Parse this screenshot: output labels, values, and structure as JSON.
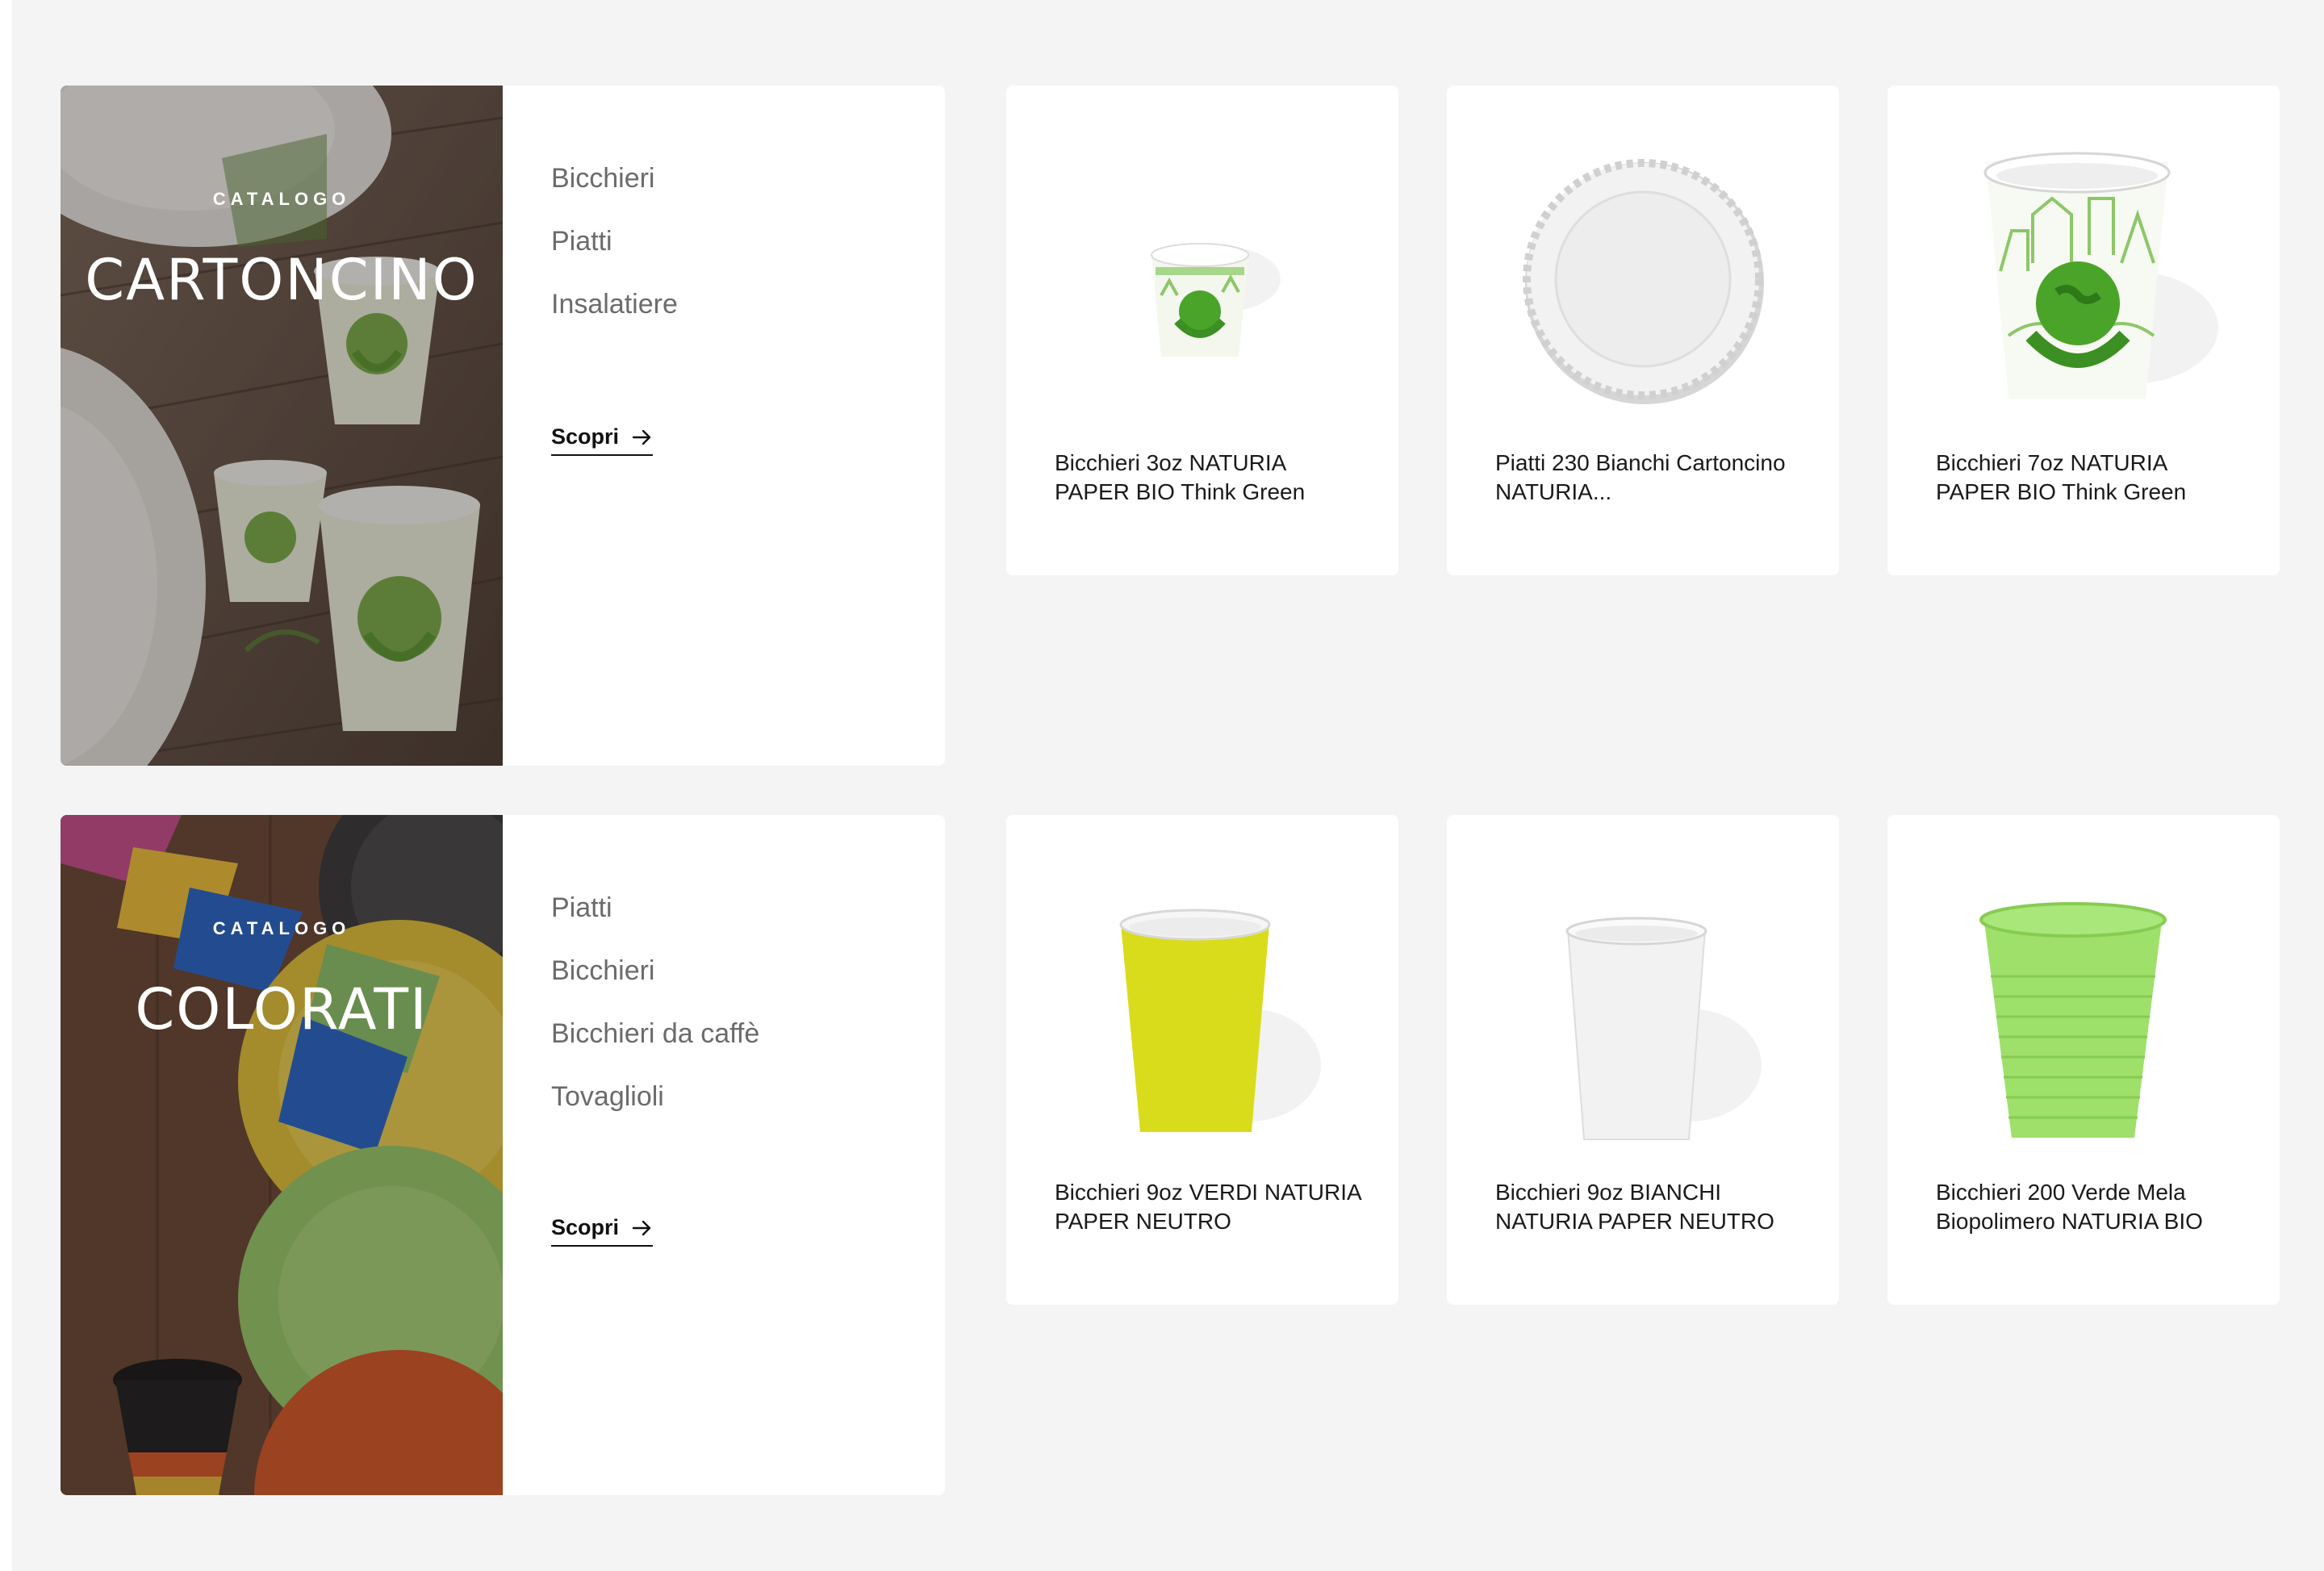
{
  "catalogs": [
    {
      "eyebrow": "CATALOGO",
      "title": "CARTONCINO",
      "links": [
        "Bicchieri",
        "Piatti",
        "Insalatiere"
      ],
      "cta": "Scopri",
      "products": [
        {
          "name": "Bicchieri 3oz NATURIA PAPER BIO Think Green",
          "visual": "small-green-print-cup"
        },
        {
          "name": "Piatti 230 Bianchi Cartoncino NATURIA...",
          "visual": "white-scalloped-plate"
        },
        {
          "name": "Bicchieri 7oz NATURIA PAPER BIO Think Green",
          "visual": "green-print-cup"
        }
      ]
    },
    {
      "eyebrow": "CATALOGO",
      "title": "COLORATI",
      "links": [
        "Piatti",
        "Bicchieri",
        "Bicchieri da caffè",
        "Tovaglioli"
      ],
      "cta": "Scopri",
      "products": [
        {
          "name": "Bicchieri 9oz VERDI NATURIA PAPER NEUTRO",
          "visual": "yellow-paper-cup",
          "color": "#d9dc1a"
        },
        {
          "name": "Bicchieri 9oz BIANCHI NATURIA PAPER NEUTRO",
          "visual": "white-paper-cup",
          "color": "#f2f2f2"
        },
        {
          "name": "Bicchieri 200 Verde Mela Biopolimero NATURIA BIO",
          "visual": "apple-green-plastic-cup",
          "color": "#9ee06a"
        }
      ]
    }
  ],
  "icons": {
    "cta_arrow": "arrow-right-icon"
  },
  "colors": {
    "page_bg": "#f4f4f4",
    "card_bg": "#ffffff",
    "link_text": "#6b6b6b",
    "brand_green": "#4aa42a"
  }
}
